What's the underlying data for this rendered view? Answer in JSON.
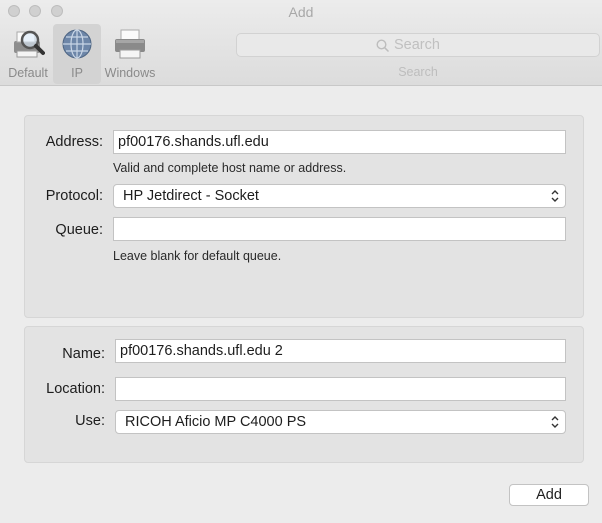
{
  "window": {
    "title": "Add"
  },
  "toolbar": {
    "tools": [
      {
        "label": "Default",
        "icon": "magnifier-printer-icon"
      },
      {
        "label": "IP",
        "icon": "globe-icon",
        "selected": true
      },
      {
        "label": "Windows",
        "icon": "printer-icon"
      }
    ],
    "search": {
      "placeholder": "Search",
      "caption": "Search"
    }
  },
  "ip_group": {
    "address_label": "Address:",
    "address_value": "pf00176.shands.ufl.edu",
    "address_hint": "Valid and complete host name or address.",
    "protocol_label": "Protocol:",
    "protocol_value": "HP Jetdirect - Socket",
    "queue_label": "Queue:",
    "queue_value": "",
    "queue_hint": "Leave blank for default queue."
  },
  "printer_group": {
    "name_label": "Name:",
    "name_value": "pf00176.shands.ufl.edu 2",
    "location_label": "Location:",
    "location_value": "",
    "use_label": "Use:",
    "use_value": "RICOH Aficio MP C4000 PS"
  },
  "footer": {
    "add_label": "Add"
  }
}
